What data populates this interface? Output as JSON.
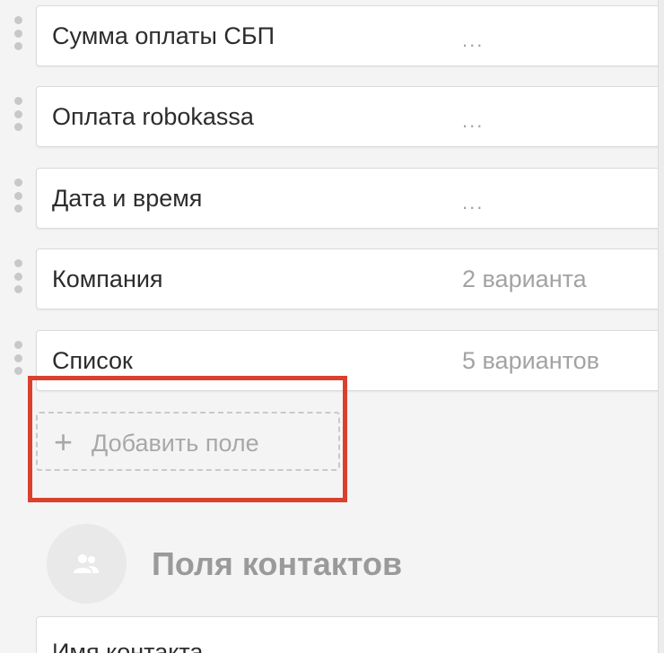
{
  "fields": [
    {
      "name": "Сумма оплаты СБП",
      "value": "..."
    },
    {
      "name": "Оплата robokassa",
      "value": "..."
    },
    {
      "name": "Дата и время",
      "value": "..."
    },
    {
      "name": "Компания",
      "value": "2 варианта"
    },
    {
      "name": "Список",
      "value": "5 вариантов"
    }
  ],
  "add_field": {
    "icon": "plus-icon",
    "label": "Добавить поле"
  },
  "highlight_color": "#d9412e",
  "contacts_section": {
    "icon": "users-icon",
    "title": "Поля контактов",
    "first_field": "Имя контакта"
  }
}
